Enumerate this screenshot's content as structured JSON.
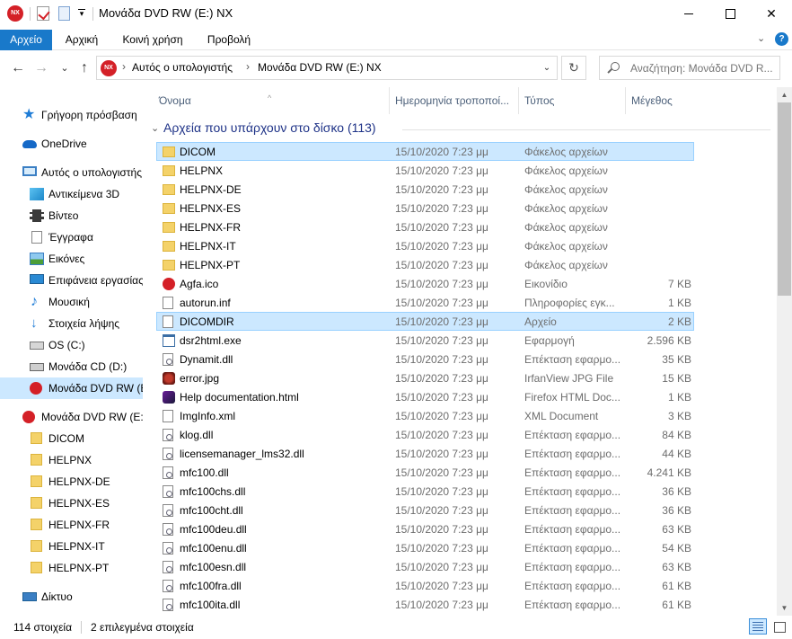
{
  "window": {
    "title": "Μονάδα DVD RW (E:) NX",
    "app_icon_text": "NX",
    "minimize": "",
    "maximize": "",
    "close": "✕"
  },
  "ribbon": {
    "tabs": [
      {
        "label": "Αρχείο"
      },
      {
        "label": "Αρχική"
      },
      {
        "label": "Κοινή χρήση"
      },
      {
        "label": "Προβολή"
      }
    ],
    "expand_icon": "⌄",
    "help_icon": "?"
  },
  "navigation": {
    "back": "←",
    "forward": "→",
    "recent": "⌄",
    "up": "↑",
    "breadcrumb": [
      "Αυτός ο υπολογιστής",
      "Μονάδα DVD RW (E:) NX"
    ],
    "breadcrumb_sep": "›",
    "dropdown": "⌄",
    "refresh": "↻",
    "search_placeholder": "Αναζήτηση: Μονάδα DVD R..."
  },
  "sidebar": {
    "items": [
      {
        "label": "Γρήγορη πρόσβαση",
        "icon": "star-icon"
      },
      {
        "label": "OneDrive",
        "icon": "cloud-icon"
      },
      {
        "label": "Αυτός ο υπολογιστής",
        "icon": "computer-icon"
      },
      {
        "label": "Αντικείμενα 3D",
        "icon": "cube-3d-icon"
      },
      {
        "label": "Βίντεο",
        "icon": "video-icon"
      },
      {
        "label": "Έγγραφα",
        "icon": "document-icon"
      },
      {
        "label": "Εικόνες",
        "icon": "pictures-icon"
      },
      {
        "label": "Επιφάνεια εργασίας",
        "icon": "desktop-icon"
      },
      {
        "label": "Μουσική",
        "icon": "music-icon"
      },
      {
        "label": "Στοιχεία λήψης",
        "icon": "download-icon"
      },
      {
        "label": "OS (C:)",
        "icon": "hard-drive-icon"
      },
      {
        "label": "Μονάδα CD (D:)",
        "icon": "cd-drive-icon"
      },
      {
        "label": "Μονάδα DVD RW (E:) NX",
        "icon": "dvd-drive-icon",
        "selected": true
      },
      {
        "label": "Μονάδα DVD RW (E:) NX",
        "icon": "dvd-drive-icon"
      },
      {
        "label": "DICOM",
        "icon": "folder-icon"
      },
      {
        "label": "HELPNX",
        "icon": "folder-icon"
      },
      {
        "label": "HELPNX-DE",
        "icon": "folder-icon"
      },
      {
        "label": "HELPNX-ES",
        "icon": "folder-icon"
      },
      {
        "label": "HELPNX-FR",
        "icon": "folder-icon"
      },
      {
        "label": "HELPNX-IT",
        "icon": "folder-icon"
      },
      {
        "label": "HELPNX-PT",
        "icon": "folder-icon"
      },
      {
        "label": "Δίκτυο",
        "icon": "network-icon"
      }
    ]
  },
  "columns": {
    "name": "Όνομα",
    "date": "Ημερομηνία τροποποί...",
    "type": "Τύπος",
    "size": "Μέγεθος",
    "sort_indicator": "^"
  },
  "group": {
    "chevron": "⌄",
    "title": "Αρχεία που υπάρχουν στο δίσκο (113)"
  },
  "files": [
    {
      "name": "DICOM",
      "date": "15/10/2020 7:23 μμ",
      "type": "Φάκελος αρχείων",
      "size": "",
      "icon": "folder-icon",
      "selected": true
    },
    {
      "name": "HELPNX",
      "date": "15/10/2020 7:23 μμ",
      "type": "Φάκελος αρχείων",
      "size": "",
      "icon": "folder-icon"
    },
    {
      "name": "HELPNX-DE",
      "date": "15/10/2020 7:23 μμ",
      "type": "Φάκελος αρχείων",
      "size": "",
      "icon": "folder-icon"
    },
    {
      "name": "HELPNX-ES",
      "date": "15/10/2020 7:23 μμ",
      "type": "Φάκελος αρχείων",
      "size": "",
      "icon": "folder-icon"
    },
    {
      "name": "HELPNX-FR",
      "date": "15/10/2020 7:23 μμ",
      "type": "Φάκελος αρχείων",
      "size": "",
      "icon": "folder-icon"
    },
    {
      "name": "HELPNX-IT",
      "date": "15/10/2020 7:23 μμ",
      "type": "Φάκελος αρχείων",
      "size": "",
      "icon": "folder-icon"
    },
    {
      "name": "HELPNX-PT",
      "date": "15/10/2020 7:23 μμ",
      "type": "Φάκελος αρχείων",
      "size": "",
      "icon": "folder-icon"
    },
    {
      "name": "Agfa.ico",
      "date": "15/10/2020 7:23 μμ",
      "type": "Εικονίδιο",
      "size": "7 KB",
      "icon": "agfa-icon"
    },
    {
      "name": "autorun.inf",
      "date": "15/10/2020 7:23 μμ",
      "type": "Πληροφορίες εγκ...",
      "size": "1 KB",
      "icon": "settings-file-icon"
    },
    {
      "name": "DICOMDIR",
      "date": "15/10/2020 7:23 μμ",
      "type": "Αρχείο",
      "size": "2 KB",
      "icon": "blank-file-icon",
      "selected": true
    },
    {
      "name": "dsr2html.exe",
      "date": "15/10/2020 7:23 μμ",
      "type": "Εφαρμογή",
      "size": "2.596 KB",
      "icon": "application-icon"
    },
    {
      "name": "Dynamit.dll",
      "date": "15/10/2020 7:23 μμ",
      "type": "Επέκταση εφαρμο...",
      "size": "35 KB",
      "icon": "dll-icon"
    },
    {
      "name": "error.jpg",
      "date": "15/10/2020 7:23 μμ",
      "type": "IrfanView JPG File",
      "size": "15 KB",
      "icon": "image-file-icon"
    },
    {
      "name": "Help documentation.html",
      "date": "15/10/2020 7:23 μμ",
      "type": "Firefox HTML Doc...",
      "size": "1 KB",
      "icon": "html-file-icon"
    },
    {
      "name": "ImgInfo.xml",
      "date": "15/10/2020 7:23 μμ",
      "type": "XML Document",
      "size": "3 KB",
      "icon": "xml-file-icon"
    },
    {
      "name": "klog.dll",
      "date": "15/10/2020 7:23 μμ",
      "type": "Επέκταση εφαρμο...",
      "size": "84 KB",
      "icon": "dll-icon"
    },
    {
      "name": "licensemanager_lms32.dll",
      "date": "15/10/2020 7:23 μμ",
      "type": "Επέκταση εφαρμο...",
      "size": "44 KB",
      "icon": "dll-icon"
    },
    {
      "name": "mfc100.dll",
      "date": "15/10/2020 7:23 μμ",
      "type": "Επέκταση εφαρμο...",
      "size": "4.241 KB",
      "icon": "dll-icon"
    },
    {
      "name": "mfc100chs.dll",
      "date": "15/10/2020 7:23 μμ",
      "type": "Επέκταση εφαρμο...",
      "size": "36 KB",
      "icon": "dll-icon"
    },
    {
      "name": "mfc100cht.dll",
      "date": "15/10/2020 7:23 μμ",
      "type": "Επέκταση εφαρμο...",
      "size": "36 KB",
      "icon": "dll-icon"
    },
    {
      "name": "mfc100deu.dll",
      "date": "15/10/2020 7:23 μμ",
      "type": "Επέκταση εφαρμο...",
      "size": "63 KB",
      "icon": "dll-icon"
    },
    {
      "name": "mfc100enu.dll",
      "date": "15/10/2020 7:23 μμ",
      "type": "Επέκταση εφαρμο...",
      "size": "54 KB",
      "icon": "dll-icon"
    },
    {
      "name": "mfc100esn.dll",
      "date": "15/10/2020 7:23 μμ",
      "type": "Επέκταση εφαρμο...",
      "size": "63 KB",
      "icon": "dll-icon"
    },
    {
      "name": "mfc100fra.dll",
      "date": "15/10/2020 7:23 μμ",
      "type": "Επέκταση εφαρμο...",
      "size": "61 KB",
      "icon": "dll-icon"
    },
    {
      "name": "mfc100ita.dll",
      "date": "15/10/2020 7:23 μμ",
      "type": "Επέκταση εφαρμο...",
      "size": "61 KB",
      "icon": "dll-icon"
    }
  ],
  "scrollbar": {
    "up": "▲",
    "down": "▼"
  },
  "status": {
    "item_count": "114 στοιχεία",
    "selected_count": "2 επιλεγμένα στοιχεία"
  }
}
